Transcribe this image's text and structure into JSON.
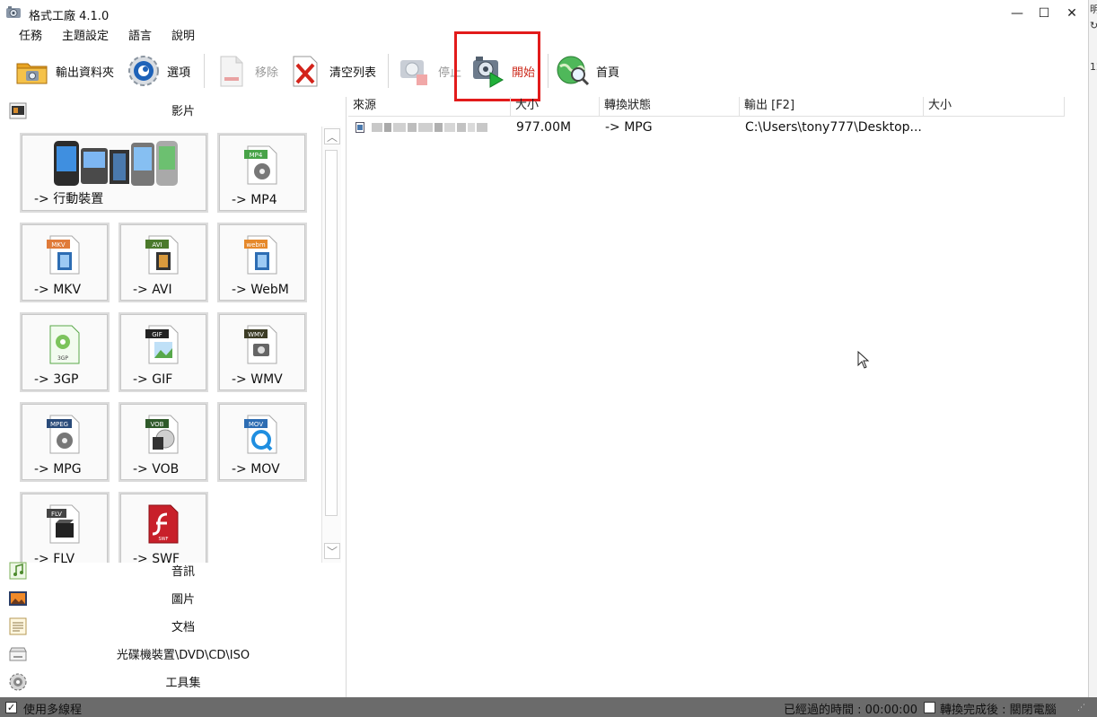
{
  "window": {
    "title": "格式工廠 4.1.0",
    "controls": {
      "minimize": "—",
      "maximize": "☐",
      "close": "✕"
    }
  },
  "menu": [
    "任務",
    "主題設定",
    "語言",
    "說明"
  ],
  "toolbar": {
    "output_folder": "輸出資料夾",
    "options": "選項",
    "remove": "移除",
    "clear_list": "清空列表",
    "stop": "停止",
    "start": "開始",
    "home": "首頁"
  },
  "categories": {
    "video": "影片",
    "audio": "音訊",
    "image": "圖片",
    "document": "文档",
    "disc": "光碟機裝置\\DVD\\CD\\ISO",
    "tools": "工具集"
  },
  "video_tiles": [
    {
      "label": "-> 行動裝置",
      "badge": ""
    },
    {
      "label": "-> MP4",
      "badge": "MP4"
    },
    {
      "label": "-> MKV",
      "badge": "MKV"
    },
    {
      "label": "-> AVI",
      "badge": "AVI"
    },
    {
      "label": "-> WebM",
      "badge": "webm"
    },
    {
      "label": "-> 3GP",
      "badge": "3GP"
    },
    {
      "label": "-> GIF",
      "badge": "GIF"
    },
    {
      "label": "-> WMV",
      "badge": "WMV"
    },
    {
      "label": "-> MPG",
      "badge": "MPEG"
    },
    {
      "label": "-> VOB",
      "badge": "VOB"
    },
    {
      "label": "-> MOV",
      "badge": "MOV"
    },
    {
      "label": "-> FLV",
      "badge": "FLV"
    },
    {
      "label": "-> SWF",
      "badge": "SWF"
    }
  ],
  "list": {
    "columns": [
      "來源",
      "大小",
      "轉換狀態",
      "輸出 [F2]",
      "大小"
    ],
    "rows": [
      {
        "source": "",
        "size": "977.00M",
        "status": "-> MPG",
        "output": "C:\\Users\\tony777\\Desktop...",
        "out_size": ""
      }
    ]
  },
  "status": {
    "multithread": "使用多線程",
    "elapsed": "已經過的時間 : 00:00:00",
    "after_done": "轉換完成後 : 關閉電腦"
  },
  "colors": {
    "highlight": "#e21b1b",
    "start_label": "#cc2b1d",
    "status_bg": "#6b6b6b"
  }
}
